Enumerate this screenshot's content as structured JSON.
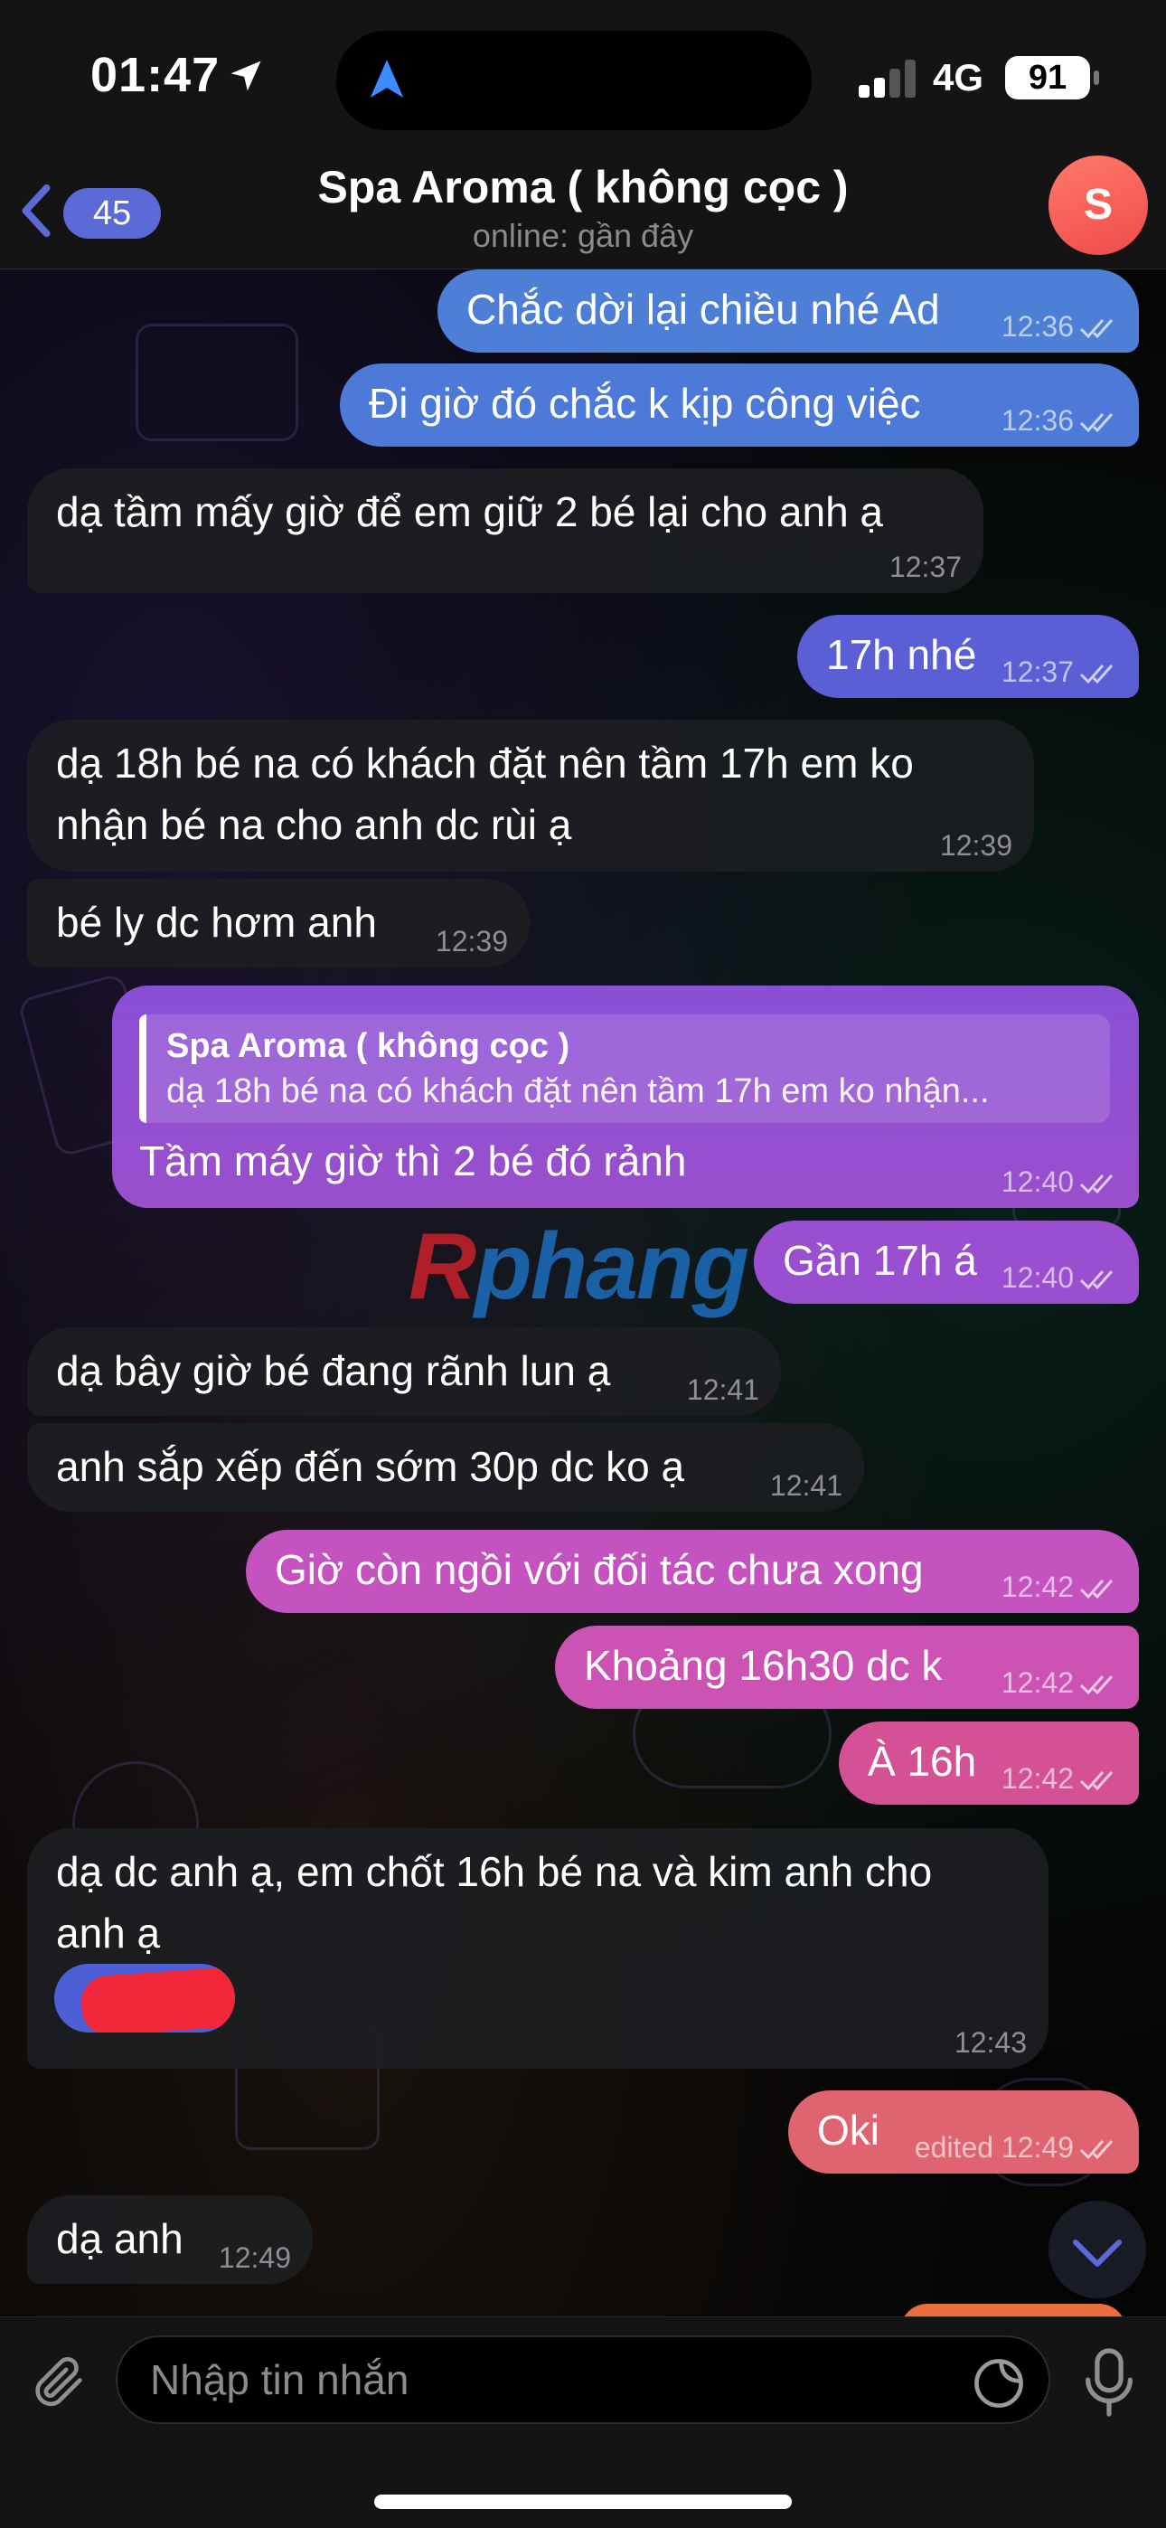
{
  "status_bar": {
    "time": "01:47",
    "network": "4G",
    "battery": "91"
  },
  "header": {
    "back_count": "45",
    "title": "Spa Aroma ( không cọc )",
    "status": "online: gần đây",
    "avatar_letter": "S"
  },
  "messages": [
    {
      "dir": "out",
      "text": [
        "Chắc dời lại chiều nhé Ad"
      ],
      "time": "12:36",
      "color": "#4e7fd6"
    },
    {
      "dir": "out",
      "text": [
        "Đi giờ đó chắc k kịp công việc"
      ],
      "time": "12:36",
      "color": "#4d7ad8"
    },
    {
      "dir": "in",
      "text": [
        "dạ tầm mấy giờ để em giữ 2 bé lại cho anh ạ"
      ],
      "time": "12:37"
    },
    {
      "dir": "out",
      "text": [
        "17h nhé"
      ],
      "time": "12:37",
      "color": "#5a5fd6"
    },
    {
      "dir": "in",
      "text": [
        "dạ 18h bé na có khách đặt nên tầm 17h em ko",
        "nhận bé na cho anh dc rùi ạ"
      ],
      "time": "12:39"
    },
    {
      "dir": "in",
      "text": [
        "bé ly dc hơm anh"
      ],
      "time": "12:39"
    },
    {
      "dir": "out",
      "text": [
        "Tầm máy giờ thì 2 bé đó rảnh"
      ],
      "time": "12:40",
      "color": "#8a4fd2",
      "reply": {
        "name": "Spa Aroma ( không cọc )",
        "text": "dạ 18h bé na có khách đặt nên tầm 17h em ko nhận..."
      }
    },
    {
      "dir": "out",
      "text": [
        "Gần 17h á"
      ],
      "time": "12:40",
      "color": "#9a4fd0"
    },
    {
      "dir": "in",
      "text": [
        "dạ bây giờ bé đang rãnh lun ạ"
      ],
      "time": "12:41"
    },
    {
      "dir": "in",
      "text": [
        "anh sắp xếp đến sớm 30p dc ko ạ"
      ],
      "time": "12:41"
    },
    {
      "dir": "out",
      "text": [
        "Giờ còn ngồi với đối tác chưa xong"
      ],
      "time": "12:42",
      "color": "#c453c0"
    },
    {
      "dir": "out",
      "text": [
        "Khoảng 16h30 dc k"
      ],
      "time": "12:42",
      "color": "#cc52b4"
    },
    {
      "dir": "out",
      "text": [
        "À 16h"
      ],
      "time": "12:42",
      "color": "#d45196"
    },
    {
      "dir": "in",
      "text": [
        "dạ dc anh ạ, em chốt 16h bé na và kim anh cho",
        "anh ạ"
      ],
      "time": "12:43"
    },
    {
      "dir": "out",
      "text": [
        "Oki"
      ],
      "time": "12:49",
      "edited": "edited",
      "color": "#e0646f"
    },
    {
      "dir": "in",
      "text": [
        "dạ anh"
      ],
      "time": "12:49"
    }
  ],
  "watermark": {
    "prefix": "R",
    "rest": "phang"
  },
  "composer": {
    "placeholder": "Nhập tin nhắn"
  },
  "icons": [
    "location-arrow-icon",
    "navigation-icon",
    "back-chevron-icon",
    "double-check-icon",
    "paperclip-icon",
    "sticker-icon",
    "microphone-icon",
    "chevron-down-icon"
  ]
}
